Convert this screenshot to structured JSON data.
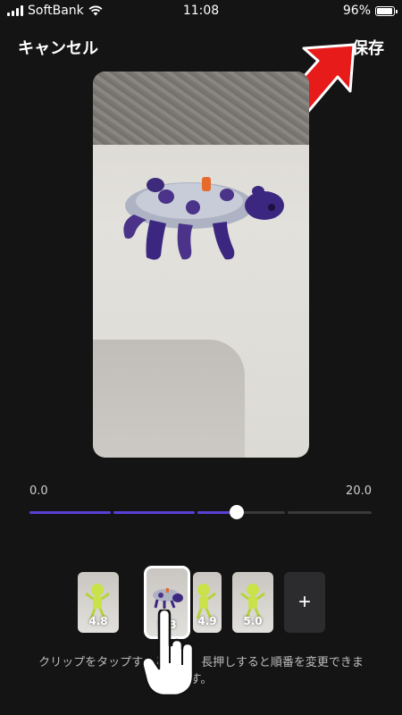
{
  "status": {
    "carrier": "SoftBank",
    "time": "11:08",
    "battery_label": "96%",
    "battery_level": 0.96
  },
  "header": {
    "cancel_label": "キャンセル",
    "save_label": "保存"
  },
  "timeline": {
    "start_label": "0.0",
    "end_label": "20.0",
    "playhead_position": 0.61
  },
  "clips": [
    {
      "duration": "4.8"
    },
    {
      "duration": "5.3",
      "selected": true
    },
    {
      "duration": "4.9"
    },
    {
      "duration": "5.0"
    }
  ],
  "add_clip_label": "+",
  "hint": "クリップをタップすると編集、長押しすると順番を変更できます。",
  "colors": {
    "accent": "#5b3fd6",
    "background": "#141414",
    "arrow": "#e81b1b"
  }
}
